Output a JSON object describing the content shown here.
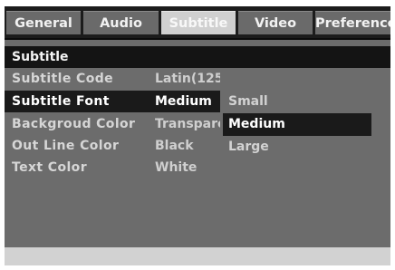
{
  "tabs": [
    {
      "label": "General",
      "active": false
    },
    {
      "label": "Audio",
      "active": false
    },
    {
      "label": "Subtitle",
      "active": true
    },
    {
      "label": "Video",
      "active": false
    },
    {
      "label": "Preference",
      "active": false
    }
  ],
  "section": {
    "title": "Subtitle"
  },
  "settings": [
    {
      "label": "Subtitle Code",
      "value": "Latin(125"
    },
    {
      "label": "Subtitle Font",
      "value": "Medium",
      "selected": true
    },
    {
      "label": "Backgroud Color",
      "value": "Transpare"
    },
    {
      "label": "Out Line Color",
      "value": "Black"
    },
    {
      "label": "Text Color",
      "value": "White"
    }
  ],
  "font_options": [
    {
      "label": "Small"
    },
    {
      "label": "Medium",
      "selected": true
    },
    {
      "label": "Large"
    }
  ],
  "colors": {
    "background": "#1a1a1a",
    "tab": "#6a6a6a",
    "tab_active": "#d0d0d0",
    "panel": "#6c6c6c",
    "highlight": "#1a1a1a",
    "footer": "#d2d2d2"
  }
}
